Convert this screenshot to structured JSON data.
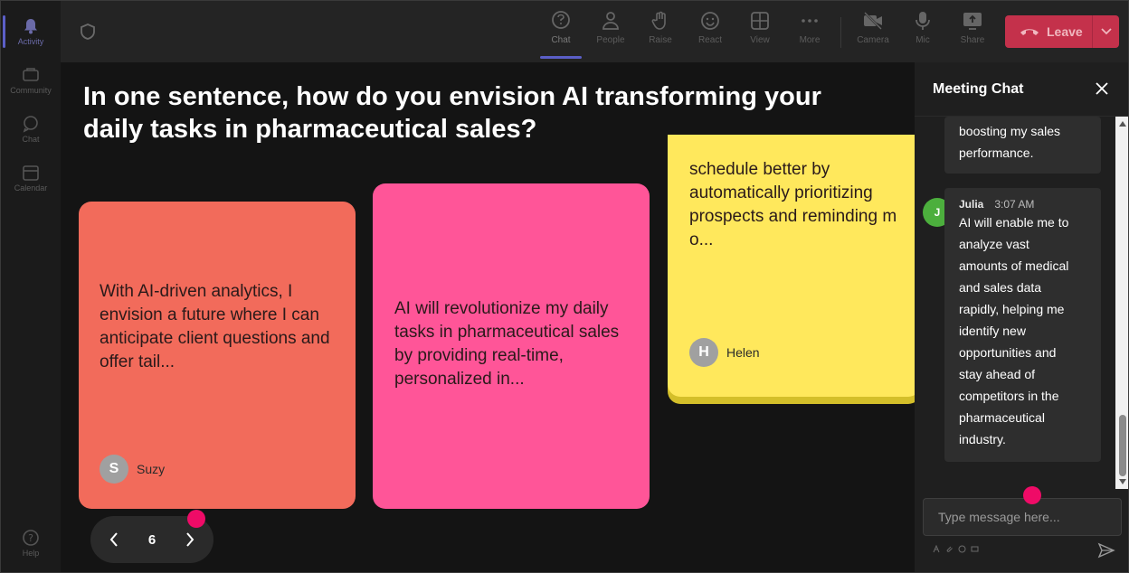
{
  "rail": {
    "items": [
      {
        "label": "Activity",
        "icon": "bell-icon",
        "active": true
      },
      {
        "label": "Community",
        "icon": "community-icon",
        "active": false
      },
      {
        "label": "Chat",
        "icon": "chat-icon",
        "active": false
      },
      {
        "label": "Calendar",
        "icon": "calendar-icon",
        "active": false
      }
    ],
    "help_label": "Help"
  },
  "toolbar": {
    "chat": "Chat",
    "people": "People",
    "raise": "Raise",
    "react": "React",
    "view": "View",
    "more": "More",
    "camera": "Camera",
    "mic": "Mic",
    "share": "Share",
    "leave": "Leave"
  },
  "question": "In one sentence, how do you envision AI transforming your daily tasks in pharmaceutical sales?",
  "cards": [
    {
      "text": "With AI-driven analytics, I envision a future where I can anticipate client questions and offer tail...",
      "author": "Suzy",
      "initial": "S",
      "color": "#f26b5b"
    },
    {
      "text": "AI will revolutionize my daily tasks in pharmaceutical sales by providing real-time, personalized in...",
      "author": "",
      "initial": "",
      "color": "#ff5598"
    },
    {
      "text": "schedule better by automatically prioritizing prospects and reminding m o...",
      "author": "Helen",
      "initial": "H",
      "color": "#ffe85c"
    }
  ],
  "pager": {
    "page": "6"
  },
  "chat": {
    "title": "Meeting Chat",
    "messages": [
      {
        "text_lines": [
          "boosting my sales",
          "performance."
        ]
      },
      {
        "name": "Julia",
        "time": "3:07 AM",
        "initial": "J",
        "text_lines": [
          "AI will enable me to",
          "analyze vast",
          "amounts of medical",
          "and sales data",
          "rapidly, helping me",
          "identify new",
          "opportunities and",
          "stay ahead of",
          "competitors in the",
          "pharmaceutical",
          "industry."
        ]
      }
    ],
    "placeholder": "Type message here..."
  },
  "colors": {
    "accent": "#5b5fc7",
    "leave": "#c4314b",
    "pink_dot": "#ef0b67"
  }
}
